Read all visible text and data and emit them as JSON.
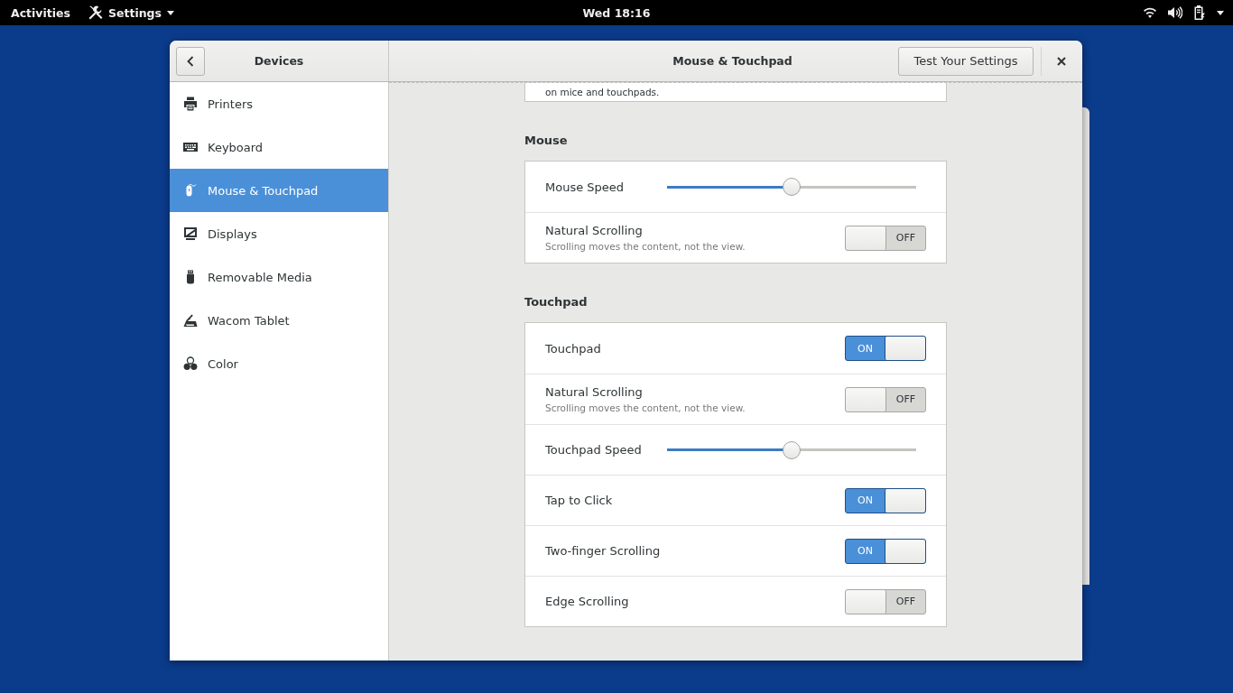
{
  "top_bar": {
    "activities": "Activities",
    "app_menu": "Settings",
    "clock": "Wed 18:16"
  },
  "header": {
    "sidebar_title": "Devices",
    "title": "Mouse & Touchpad",
    "test_button": "Test Your Settings"
  },
  "sidebar": {
    "items": [
      {
        "label": "Printers",
        "selected": false
      },
      {
        "label": "Keyboard",
        "selected": false
      },
      {
        "label": "Mouse & Touchpad",
        "selected": true
      },
      {
        "label": "Displays",
        "selected": false
      },
      {
        "label": "Removable Media",
        "selected": false
      },
      {
        "label": "Wacom Tablet",
        "selected": false
      },
      {
        "label": "Color",
        "selected": false
      }
    ]
  },
  "content": {
    "intro_fragment": "on mice and touchpads.",
    "sections": [
      {
        "title": "Mouse",
        "rows": [
          {
            "kind": "slider",
            "label": "Mouse Speed",
            "level": 0.5
          },
          {
            "kind": "switch",
            "label": "Natural Scrolling",
            "description": "Scrolling moves the content, not the view.",
            "on": false,
            "switch_text": "OFF"
          }
        ]
      },
      {
        "title": "Touchpad",
        "rows": [
          {
            "kind": "switch",
            "label": "Touchpad",
            "on": true,
            "switch_text": "ON"
          },
          {
            "kind": "switch",
            "label": "Natural Scrolling",
            "description": "Scrolling moves the content, not the view.",
            "on": false,
            "switch_text": "OFF"
          },
          {
            "kind": "slider",
            "label": "Touchpad Speed",
            "level": 0.5
          },
          {
            "kind": "switch",
            "label": "Tap to Click",
            "on": true,
            "switch_text": "ON"
          },
          {
            "kind": "switch",
            "label": "Two-finger Scrolling",
            "on": true,
            "switch_text": "ON"
          },
          {
            "kind": "switch",
            "label": "Edge Scrolling",
            "on": false,
            "switch_text": "OFF"
          }
        ]
      }
    ]
  }
}
